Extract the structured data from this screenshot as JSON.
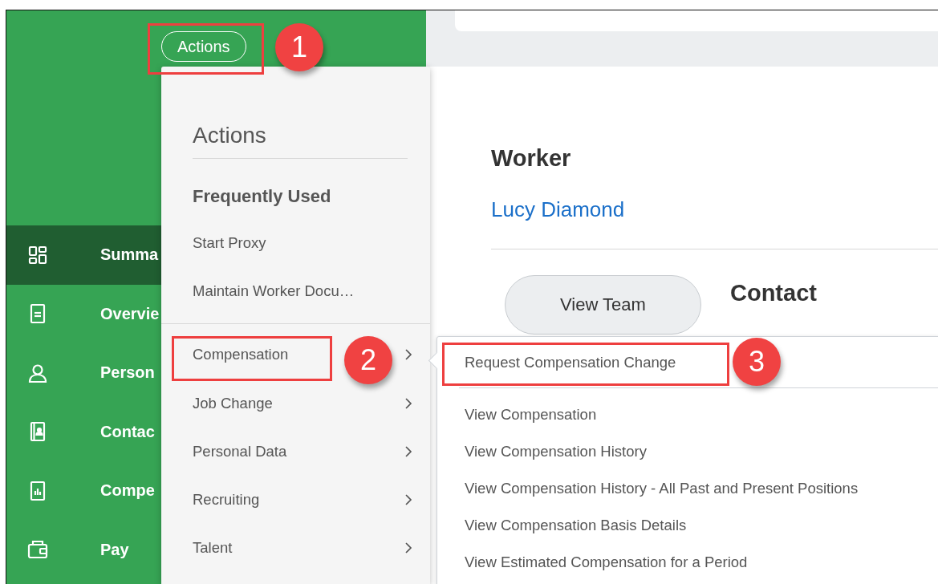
{
  "header": {
    "actions_button": "Actions"
  },
  "sidebar": {
    "items": [
      {
        "label": "Summa",
        "selected": true
      },
      {
        "label": "Overvie",
        "selected": false
      },
      {
        "label": "Person",
        "selected": false
      },
      {
        "label": "Contac",
        "selected": false
      },
      {
        "label": "Compe",
        "selected": false
      },
      {
        "label": "Pay",
        "selected": false
      }
    ]
  },
  "actions_menu": {
    "title": "Actions",
    "sections": [
      {
        "heading": "Frequently Used",
        "items": [
          {
            "label": "Start Proxy",
            "submenu": false
          },
          {
            "label": "Maintain Worker Docu…",
            "submenu": false
          }
        ]
      },
      {
        "items": [
          {
            "label": "Compensation",
            "submenu": true
          },
          {
            "label": "Job Change",
            "submenu": true
          },
          {
            "label": "Personal Data",
            "submenu": true
          },
          {
            "label": "Recruiting",
            "submenu": true
          },
          {
            "label": "Talent",
            "submenu": true
          }
        ]
      }
    ]
  },
  "submenu": {
    "items": [
      {
        "label": "Request Compensation Change"
      },
      {
        "label": "View Compensation"
      },
      {
        "label": "View Compensation History"
      },
      {
        "label": "View Compensation History - All Past and Present Positions"
      },
      {
        "label": "View Compensation Basis Details"
      },
      {
        "label": "View Estimated Compensation for a Period"
      }
    ]
  },
  "worker": {
    "heading": "Worker",
    "name": "Lucy Diamond",
    "view_team_button": "View Team",
    "contact_heading": "Contact"
  },
  "annotations": [
    {
      "number": "1"
    },
    {
      "number": "2"
    },
    {
      "number": "3"
    }
  ]
}
